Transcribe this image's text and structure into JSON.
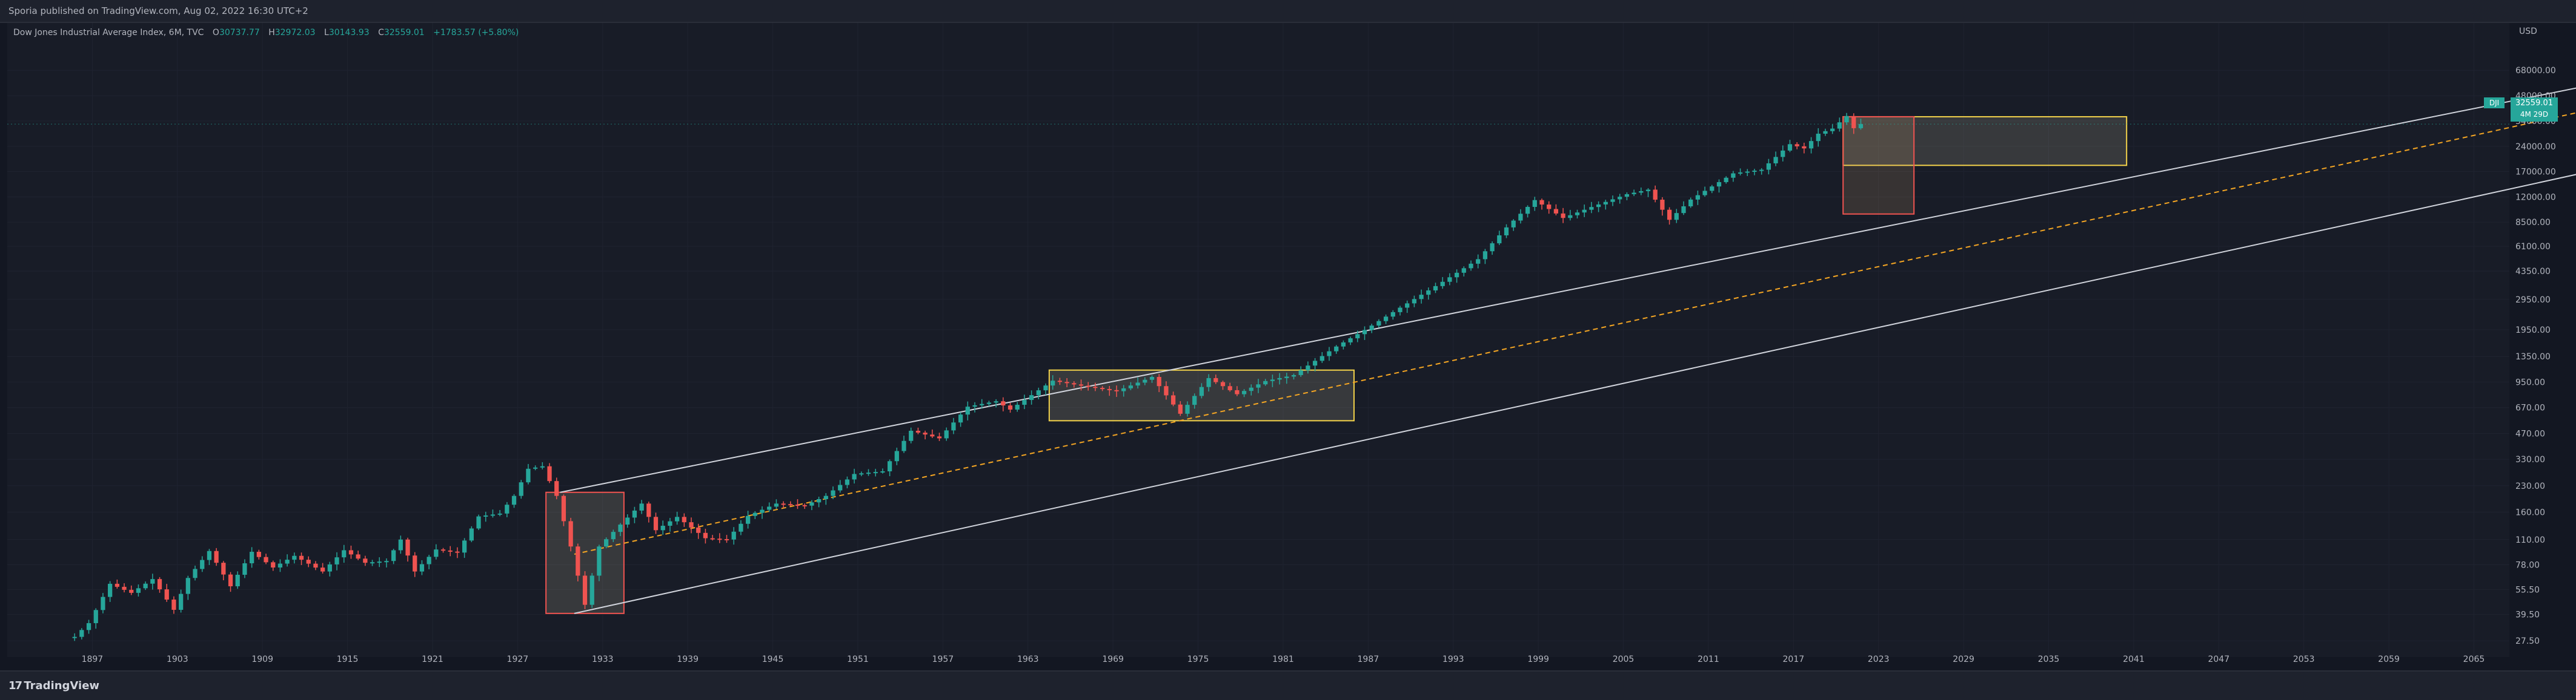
{
  "header": {
    "published_text": "Sporia published on TradingView.com, Aug 02, 2022 16:30 UTC+2"
  },
  "legend": {
    "symbol": "Dow Jones Industrial Average Index, 6M, TVC",
    "open_label": "O",
    "open_value": "30737.77",
    "high_label": "H",
    "high_value": "32972.03",
    "low_label": "L",
    "low_value": "30143.93",
    "close_label": "C",
    "close_value": "32559.01",
    "change": "+1783.57 (+5.80%)"
  },
  "price_axis": {
    "currency": "USD",
    "last_price_tag": {
      "symbol": "DJI",
      "price": "32559.01",
      "countdown": "4M 29D"
    }
  },
  "footer": {
    "logo_text": "TradingView"
  },
  "colors": {
    "up": "#26a69a",
    "down": "#ef5350",
    "background": "#131722",
    "channel": "#d1d4dc",
    "midline": "#f5a623",
    "box_yellow": "#f2d24a",
    "box_red": "#ef5350"
  },
  "chart_data": {
    "type": "candlestick",
    "scale": "log",
    "ylim": [
      22,
      130000
    ],
    "xlim": [
      1891.5,
      2068
    ],
    "y_ticks": [
      "27.50",
      "39.50",
      "55.50",
      "78.00",
      "110.00",
      "160.00",
      "230.00",
      "330.00",
      "470.00",
      "670.00",
      "950.00",
      "1350.00",
      "1950.00",
      "2950.00",
      "4350.00",
      "6100.00",
      "8500.00",
      "12000.00",
      "17000.00",
      "24000.00",
      "34000.00",
      "48000.00",
      "68000.00"
    ],
    "x_ticks": [
      "1897",
      "1903",
      "1909",
      "1915",
      "1921",
      "1927",
      "1933",
      "1939",
      "1945",
      "1951",
      "1957",
      "1963",
      "1969",
      "1975",
      "1981",
      "1987",
      "1993",
      "1999",
      "2005",
      "2011",
      "2017",
      "2023",
      "2029",
      "2035",
      "2041",
      "2047",
      "2053",
      "2059",
      "2065"
    ],
    "anchors": [
      [
        1896.5,
        29
      ],
      [
        1897.5,
        35
      ],
      [
        1899,
        60
      ],
      [
        1900.5,
        53
      ],
      [
        1902,
        64
      ],
      [
        1903.5,
        42
      ],
      [
        1904.5,
        65
      ],
      [
        1906,
        94
      ],
      [
        1907.5,
        58
      ],
      [
        1909,
        93
      ],
      [
        1910.5,
        75
      ],
      [
        1912,
        88
      ],
      [
        1914,
        71
      ],
      [
        1915.5,
        95
      ],
      [
        1917,
        80
      ],
      [
        1918.5,
        82
      ],
      [
        1919.5,
        110
      ],
      [
        1920.5,
        71
      ],
      [
        1922,
        96
      ],
      [
        1923.5,
        92
      ],
      [
        1925,
        151
      ],
      [
        1926.5,
        157
      ],
      [
        1927.5,
        200
      ],
      [
        1928.5,
        290
      ],
      [
        1929.5,
        300
      ],
      [
        1930.5,
        200
      ],
      [
        1931.5,
        100
      ],
      [
        1932.5,
        45
      ],
      [
        1933.5,
        100
      ],
      [
        1935,
        135
      ],
      [
        1936.5,
        180
      ],
      [
        1937.5,
        125
      ],
      [
        1939,
        150
      ],
      [
        1941,
        112
      ],
      [
        1942.5,
        110
      ],
      [
        1944,
        152
      ],
      [
        1946,
        180
      ],
      [
        1948,
        175
      ],
      [
        1949.5,
        200
      ],
      [
        1951.5,
        270
      ],
      [
        1953.5,
        280
      ],
      [
        1955.5,
        488
      ],
      [
        1957.5,
        440
      ],
      [
        1959.5,
        679
      ],
      [
        1961.5,
        731
      ],
      [
        1962.5,
        652
      ],
      [
        1965.5,
        969
      ],
      [
        1967.5,
        905
      ],
      [
        1970,
        839
      ],
      [
        1972.5,
        1020
      ],
      [
        1974.5,
        616
      ],
      [
        1976.5,
        1004
      ],
      [
        1978.5,
        805
      ],
      [
        1980.5,
        964
      ],
      [
        1982.5,
        1046
      ],
      [
        1985.5,
        1547
      ],
      [
        1987.5,
        1939
      ],
      [
        1990,
        2634
      ],
      [
        1993,
        3754
      ],
      [
        1995.5,
        5117
      ],
      [
        1997.5,
        7908
      ],
      [
        1999.5,
        11497
      ],
      [
        2001.5,
        9000
      ],
      [
        2003.5,
        10454
      ],
      [
        2006,
        12463
      ],
      [
        2007.5,
        13265
      ],
      [
        2009,
        8776
      ],
      [
        2010.5,
        11578
      ],
      [
        2013.5,
        16577
      ],
      [
        2015.5,
        17425
      ],
      [
        2017.5,
        24719
      ],
      [
        2018.5,
        23327
      ],
      [
        2019.5,
        28538
      ],
      [
        2020.5,
        30606
      ],
      [
        2021.5,
        36338
      ],
      [
        2022,
        30775
      ],
      [
        2022.5,
        32559
      ]
    ],
    "drawings": {
      "channel_upper": [
        [
          1930.5,
          210
        ],
        [
          2087,
          93000
        ]
      ],
      "channel_lower": [
        [
          1931.5,
          40
        ],
        [
          2087,
          30000
        ]
      ],
      "channel_mid": [
        [
          1931.5,
          90
        ],
        [
          2087,
          70000
        ]
      ],
      "box_1932": {
        "x": [
          1929.5,
          1935
        ],
        "y": [
          40,
          210
        ]
      },
      "box_1965": {
        "x": [
          1965,
          1986.5
        ],
        "y": [
          560,
          1120
        ]
      },
      "box_2021_red": {
        "x": [
          2021,
          2026
        ],
        "y": [
          9500,
          36000
        ]
      },
      "box_2021_yellow": {
        "x": [
          2021,
          2041
        ],
        "y": [
          18500,
          36000
        ]
      }
    }
  }
}
